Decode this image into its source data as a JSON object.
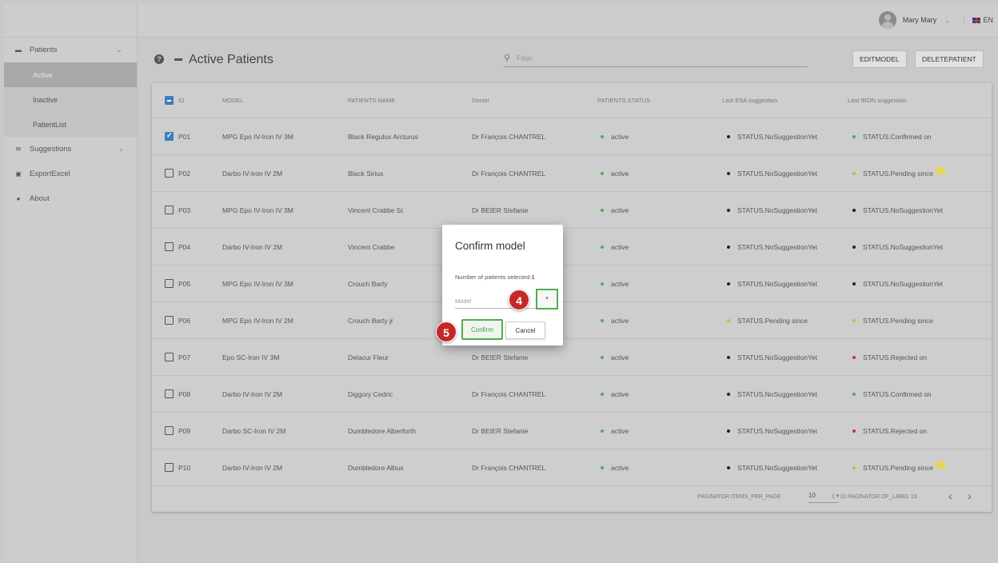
{
  "user": {
    "name": "Mary Mary",
    "language": "EN"
  },
  "sidebar": {
    "items": [
      {
        "label": "Patients",
        "icon": "bed-icon"
      },
      {
        "label": "Suggestions",
        "icon": "envelope-icon"
      },
      {
        "label": "ExportExcel",
        "icon": "excel-icon"
      },
      {
        "label": "About",
        "icon": "info-icon"
      }
    ],
    "sub_items": [
      {
        "label": "Active",
        "active": true
      },
      {
        "label": "Inactive"
      },
      {
        "label": "PatientList"
      }
    ]
  },
  "header": {
    "title": "Active Patients",
    "filter_placeholder": "Filter",
    "edit_button": "EDITMODEL",
    "delete_button": "DELETEPATIENT"
  },
  "table": {
    "columns": [
      "ID",
      "MODEL",
      "PATIENTS.NAME",
      "Doctor",
      "PATIENTS.STATUS",
      "Last ESA suggestion",
      "Last IRON suggestion"
    ],
    "rows": [
      {
        "id": "P01",
        "checked": true,
        "model": "MPG Epo IV-Iron IV 3M",
        "name": "Black Regulus Arcturus",
        "doctor": "Dr François CHANTREL",
        "status": "active",
        "esa": "STATUS.NoSuggestionYet",
        "esa_color": "#222222",
        "iron": "STATUS.Confirmed on",
        "iron_color": "#4caf50",
        "iron_note": false
      },
      {
        "id": "P02",
        "checked": false,
        "model": "Darbo IV-Iron IV 2M",
        "name": "Black Sirius",
        "doctor": "Dr François CHANTREL",
        "status": "active",
        "esa": "STATUS.NoSuggestionYet",
        "esa_color": "#222222",
        "iron": "STATUS.Pending since",
        "iron_color": "#d9b340",
        "iron_note": true
      },
      {
        "id": "P03",
        "checked": false,
        "model": "MPG Epo IV-Iron IV 3M",
        "name": "Vincent Crabbe Sr.",
        "doctor": "Dr BEIER Stefanie",
        "status": "active",
        "esa": "STATUS.NoSuggestionYet",
        "esa_color": "#222222",
        "iron": "STATUS.NoSuggestionYet",
        "iron_color": "#222222",
        "iron_note": false
      },
      {
        "id": "P04",
        "checked": false,
        "model": "Darbo IV-Iron IV 2M",
        "name": "Vincent Crabbe",
        "doctor": "",
        "status": "active",
        "esa": "STATUS.NoSuggestionYet",
        "esa_color": "#222222",
        "iron": "STATUS.NoSuggestionYet",
        "iron_color": "#222222",
        "iron_note": false
      },
      {
        "id": "P05",
        "checked": false,
        "model": "MPG Epo IV-Iron IV 3M",
        "name": "Crouch Barty",
        "doctor": "",
        "status": "active",
        "esa": "STATUS.NoSuggestionYet",
        "esa_color": "#222222",
        "iron": "STATUS.NoSuggestionYet",
        "iron_color": "#222222",
        "iron_note": false
      },
      {
        "id": "P06",
        "checked": false,
        "model": "MPG Epo IV-Iron IV 2M",
        "name": "Crouch Barty jr",
        "doctor": "",
        "status": "active",
        "esa": "STATUS.Pending since",
        "esa_color": "#d9b340",
        "iron": "STATUS.Pending since",
        "iron_color": "#d9b340",
        "iron_note": false
      },
      {
        "id": "P07",
        "checked": false,
        "model": "Epo SC-Iron IV 3M",
        "name": "Delacur Fleur",
        "doctor": "Dr BEIER Stefanie",
        "status": "active",
        "esa": "STATUS.NoSuggestionYet",
        "esa_color": "#222222",
        "iron": "STATUS.Rejected on",
        "iron_color": "#d32f2f",
        "iron_note": false
      },
      {
        "id": "P08",
        "checked": false,
        "model": "Darbo IV-Iron IV 2M",
        "name": "Diggory Cedric",
        "doctor": "Dr François CHANTREL",
        "status": "active",
        "esa": "STATUS.NoSuggestionYet",
        "esa_color": "#222222",
        "iron": "STATUS.Confirmed on",
        "iron_color": "#4caf50",
        "iron_note": false
      },
      {
        "id": "P09",
        "checked": false,
        "model": "Darbo SC-Iron IV 2M",
        "name": "Dumbledore Alberforth",
        "doctor": "Dr BEIER Stefanie",
        "status": "active",
        "esa": "STATUS.NoSuggestionYet",
        "esa_color": "#222222",
        "iron": "STATUS.Rejected on",
        "iron_color": "#d32f2f",
        "iron_note": false
      },
      {
        "id": "P10",
        "checked": false,
        "model": "Darbo IV-Iron IV 2M",
        "name": "Dumbledore Albus",
        "doctor": "Dr François CHANTREL",
        "status": "active",
        "esa": "STATUS.NoSuggestionYet",
        "esa_color": "#222222",
        "iron": "STATUS.Pending since",
        "iron_color": "#d9b340",
        "iron_note": true
      }
    ]
  },
  "paginator": {
    "items_per_page_label": "PAGINATOR.ITEMS_PER_PAGE",
    "page_size": "10",
    "range_label": "1 - 10 PAGINATOR.OF_LABEL 19",
    "prev": "‹",
    "next": "›"
  },
  "modal": {
    "title": "Confirm model",
    "count_label": "Number of patients selected:",
    "count_value": "1",
    "model_placeholder": "Model",
    "dropdown_arrow": "▾",
    "confirm": "Confirm",
    "cancel": "Cancel",
    "step_dropdown": "4",
    "step_confirm": "5"
  },
  "colors": {
    "status_active": "#4caf50",
    "highlight": "#4caf50",
    "step_badge": "#c62828",
    "checkbox": "#3d7fc1"
  }
}
